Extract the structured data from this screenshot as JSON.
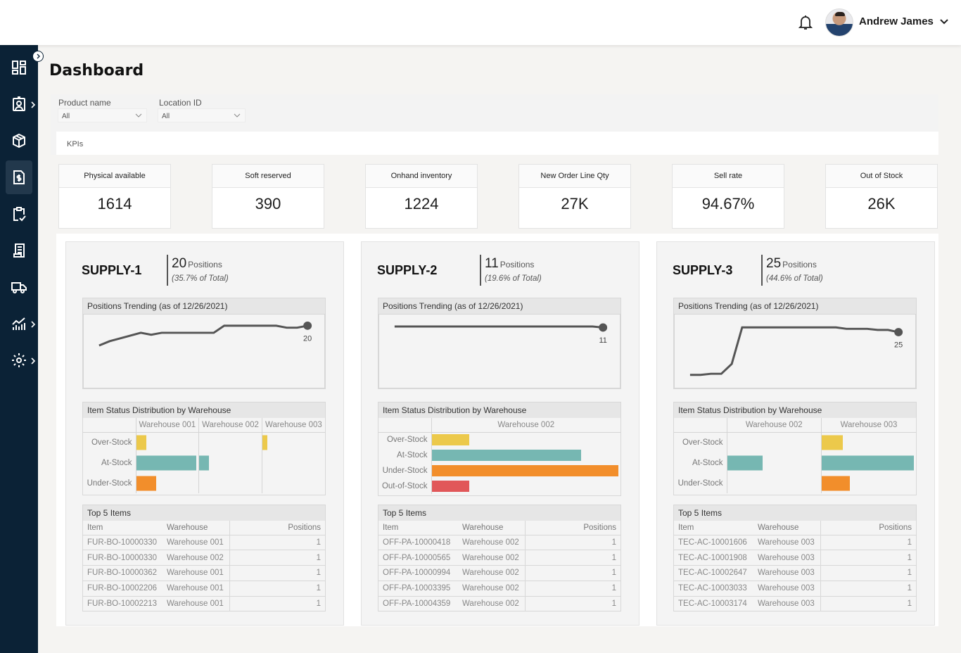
{
  "header": {
    "user_name": "Andrew James"
  },
  "sidebar": {
    "items": [
      {
        "icon": "dashboard-icon",
        "has_submenu": false,
        "active": false
      },
      {
        "icon": "user-badge-icon",
        "has_submenu": true,
        "active": false
      },
      {
        "icon": "package-icon",
        "has_submenu": false,
        "active": false
      },
      {
        "icon": "invoice-dollar-icon",
        "has_submenu": false,
        "active": true
      },
      {
        "icon": "clipboard-check-icon",
        "has_submenu": false,
        "active": false
      },
      {
        "icon": "receipt-icon",
        "has_submenu": false,
        "active": false
      },
      {
        "icon": "truck-icon",
        "has_submenu": false,
        "active": false
      },
      {
        "icon": "analytics-icon",
        "has_submenu": true,
        "active": false
      },
      {
        "icon": "settings-icon",
        "has_submenu": true,
        "active": false
      }
    ]
  },
  "page": {
    "title": "Dashboard"
  },
  "filters": {
    "product_name": {
      "label": "Product name",
      "value": "All"
    },
    "location_id": {
      "label": "Location ID",
      "value": "All"
    },
    "section_label": "KPIs"
  },
  "kpis": [
    {
      "label": "Physical available",
      "value": "1614"
    },
    {
      "label": "Soft reserved",
      "value": "390"
    },
    {
      "label": "Onhand inventory",
      "value": "1224"
    },
    {
      "label": "New Order Line Qty",
      "value": "27K"
    },
    {
      "label": "Sell rate",
      "value": "94.67%"
    },
    {
      "label": "Out of Stock",
      "value": "26K"
    }
  ],
  "colors": {
    "over_stock": "#ecc94b",
    "at_stock": "#76b7b2",
    "under_stock": "#f28e2b",
    "out_of_stock": "#e15759",
    "trend_line": "#555555"
  },
  "panels": [
    {
      "name": "SUPPLY-1",
      "positions": "20",
      "positions_label": "Positions",
      "share": "(35.7% of Total)",
      "trend_title": "Positions Trending (as of 12/26/2021)",
      "trend_end_label": "20",
      "dist_title": "Item Status Distribution by Warehouse",
      "top_title": "Top 5 Items",
      "top_columns": [
        "Item",
        "Warehouse",
        "Positions"
      ],
      "top_rows": [
        [
          "FUR-BO-10000330",
          "Warehouse 001",
          "1"
        ],
        [
          "FUR-BO-10000330",
          "Warehouse 002",
          "1"
        ],
        [
          "FUR-BO-10000362",
          "Warehouse 001",
          "1"
        ],
        [
          "FUR-BO-10002206",
          "Warehouse 001",
          "1"
        ],
        [
          "FUR-BO-10002213",
          "Warehouse 001",
          "1"
        ]
      ]
    },
    {
      "name": "SUPPLY-2",
      "positions": "11",
      "positions_label": "Positions",
      "share": "(19.6% of Total)",
      "trend_title": "Positions Trending (as of 12/26/2021)",
      "trend_end_label": "11",
      "dist_title": "Item Status Distribution by Warehouse",
      "top_title": "Top 5 Items",
      "top_columns": [
        "Item",
        "Warehouse",
        "Positions"
      ],
      "top_rows": [
        [
          "OFF-PA-10000418",
          "Warehouse 002",
          "1"
        ],
        [
          "OFF-PA-10000565",
          "Warehouse 002",
          "1"
        ],
        [
          "OFF-PA-10000994",
          "Warehouse 002",
          "1"
        ],
        [
          "OFF-PA-10003395",
          "Warehouse 002",
          "1"
        ],
        [
          "OFF-PA-10004359",
          "Warehouse 002",
          "1"
        ]
      ]
    },
    {
      "name": "SUPPLY-3",
      "positions": "25",
      "positions_label": "Positions",
      "share": "(44.6% of Total)",
      "trend_title": "Positions Trending (as of 12/26/2021)",
      "trend_end_label": "25",
      "dist_title": "Item Status Distribution by Warehouse",
      "top_title": "Top 5 Items",
      "top_columns": [
        "Item",
        "Warehouse",
        "Positions"
      ],
      "top_rows": [
        [
          "TEC-AC-10001606",
          "Warehouse 003",
          "1"
        ],
        [
          "TEC-AC-10001908",
          "Warehouse 003",
          "1"
        ],
        [
          "TEC-AC-10002647",
          "Warehouse 003",
          "1"
        ],
        [
          "TEC-AC-10003033",
          "Warehouse 003",
          "1"
        ],
        [
          "TEC-AC-10003174",
          "Warehouse 003",
          "1"
        ]
      ]
    }
  ],
  "chart_data": [
    {
      "type": "line",
      "title": "Positions Trending (as of 12/26/2021)",
      "panel": "SUPPLY-1",
      "values": [
        13,
        14.5,
        15.5,
        16.5,
        17.5,
        16.8,
        17.5,
        17.5,
        17.5,
        17.5,
        17.5,
        17.5,
        20,
        20,
        20,
        20,
        20,
        20,
        19.3,
        19.3,
        20
      ],
      "end_label": "20",
      "ylim": [
        0,
        22
      ]
    },
    {
      "type": "line",
      "title": "Positions Trending (as of 12/26/2021)",
      "panel": "SUPPLY-2",
      "values": [
        11.2,
        11.2,
        11.2,
        11.2,
        11.2,
        11.2,
        11.2,
        11.2,
        11.2,
        11.2,
        11.2,
        11.2,
        11.2,
        11.2,
        11.2,
        11.2,
        11.2,
        11.2,
        11.2,
        11.2,
        11
      ],
      "end_label": "11",
      "ylim": [
        0,
        12.5
      ]
    },
    {
      "type": "line",
      "title": "Positions Trending (as of 12/26/2021)",
      "panel": "SUPPLY-3",
      "values": [
        14,
        14,
        14.3,
        14.3,
        17,
        27,
        27,
        27,
        27,
        27,
        27,
        27,
        27,
        27,
        27,
        26.6,
        26.6,
        26.6,
        26.3,
        26.3,
        25.7
      ],
      "end_label": "25",
      "ylim": [
        12,
        29
      ]
    },
    {
      "type": "bar",
      "title": "Item Status Distribution by Warehouse",
      "panel": "SUPPLY-1",
      "categories": [
        "Over-Stock",
        "At-Stock",
        "Under-Stock"
      ],
      "series": [
        {
          "name": "Warehouse 001",
          "values": [
            1,
            6,
            2
          ]
        },
        {
          "name": "Warehouse 002",
          "values": [
            0,
            1,
            0
          ]
        },
        {
          "name": "Warehouse 003",
          "values": [
            0.5,
            0,
            0
          ]
        }
      ],
      "xlim": [
        0,
        6
      ]
    },
    {
      "type": "bar",
      "title": "Item Status Distribution by Warehouse",
      "panel": "SUPPLY-2",
      "categories": [
        "Over-Stock",
        "At-Stock",
        "Under-Stock",
        "Out-of-Stock"
      ],
      "series": [
        {
          "name": "Warehouse 002",
          "values": [
            2,
            8,
            10,
            2
          ]
        }
      ],
      "xlim": [
        0,
        10
      ]
    },
    {
      "type": "bar",
      "title": "Item Status Distribution by Warehouse",
      "panel": "SUPPLY-3",
      "categories": [
        "Over-Stock",
        "At-Stock",
        "Under-Stock"
      ],
      "series": [
        {
          "name": "Warehouse 002",
          "values": [
            0,
            5,
            0
          ]
        },
        {
          "name": "Warehouse 003",
          "values": [
            3,
            13,
            4
          ]
        }
      ],
      "xlim": [
        0,
        13
      ]
    }
  ]
}
